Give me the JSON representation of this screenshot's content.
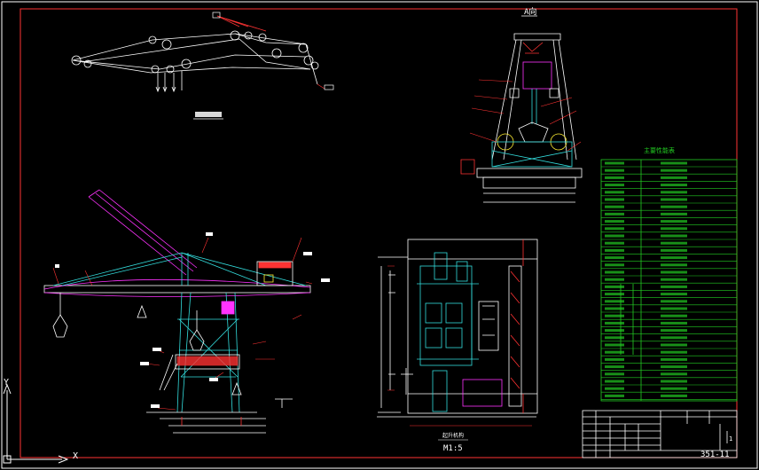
{
  "drawing": {
    "view_a_label": "A向",
    "section_label_1": "M1:5",
    "drawing_number": "351-11",
    "sheet_index": "1"
  },
  "ucs": {
    "x_label": "X",
    "y_label": "Y"
  },
  "colors": {
    "background": "#000000",
    "linework": "#ffffff",
    "table": "#22cc22",
    "cyan": "#33dddd",
    "red": "#ff3333",
    "magenta": "#ff33ff",
    "yellow": "#ffee33"
  }
}
